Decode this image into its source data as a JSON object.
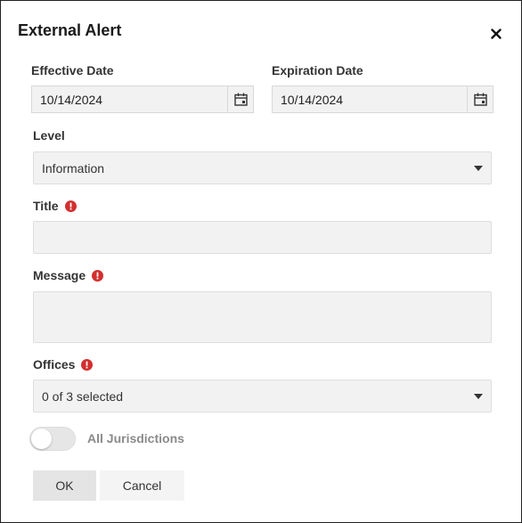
{
  "dialog": {
    "title": "External Alert",
    "close_icon": "close-icon"
  },
  "effective_date": {
    "label": "Effective Date",
    "value": "10/14/2024",
    "icon": "calendar-icon"
  },
  "expiration_date": {
    "label": "Expiration Date",
    "value": "10/14/2024",
    "icon": "calendar-icon"
  },
  "level": {
    "label": "Level",
    "value": "Information",
    "icon": "chevron-down-icon"
  },
  "title_field": {
    "label": "Title",
    "value": "",
    "required": true
  },
  "message_field": {
    "label": "Message",
    "value": "",
    "required": true
  },
  "offices": {
    "label": "Offices",
    "value": "0 of 3 selected",
    "required": true,
    "icon": "chevron-down-icon"
  },
  "all_jurisdictions": {
    "label": "All Jurisdictions",
    "enabled": false
  },
  "buttons": {
    "ok": "OK",
    "cancel": "Cancel"
  },
  "colors": {
    "required_icon": "#d32f2f",
    "field_background": "#f2f2f2",
    "ok_button": "#e4e4e4"
  }
}
